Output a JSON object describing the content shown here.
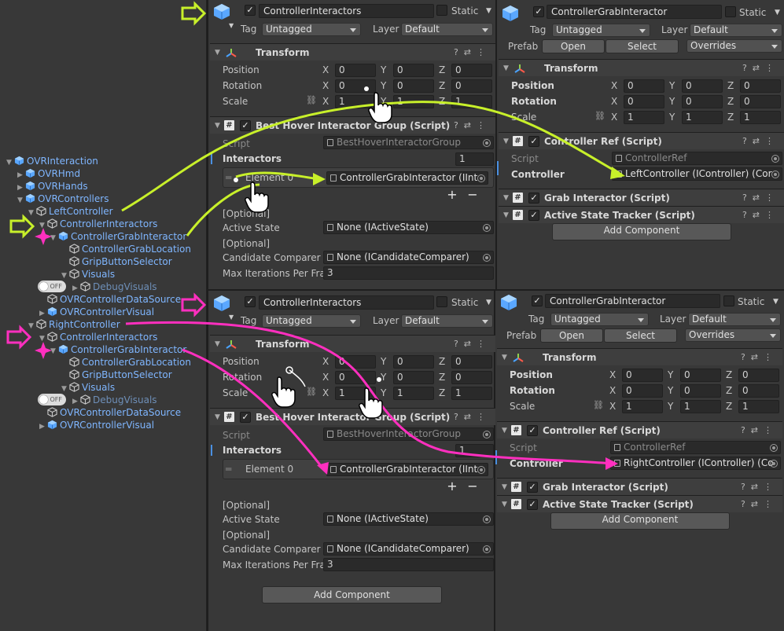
{
  "hierarchy": {
    "items": [
      {
        "label": "OVRInteraction",
        "indent": 0,
        "arrow": "▼",
        "icon": "prefab-icon"
      },
      {
        "label": "OVRHmd",
        "indent": 1,
        "arrow": "▶",
        "icon": "prefab-icon"
      },
      {
        "label": "OVRHands",
        "indent": 1,
        "arrow": "▶",
        "icon": "prefab-icon"
      },
      {
        "label": "OVRControllers",
        "indent": 1,
        "arrow": "▼",
        "icon": "prefab-icon"
      },
      {
        "label": "LeftController",
        "indent": 2,
        "arrow": "▼",
        "icon": "gameobject-icon"
      },
      {
        "label": "ControllerInteractors",
        "indent": 3,
        "arrow": "▼",
        "icon": "gameobject-icon"
      },
      {
        "label": "ControllerGrabInteractor",
        "indent": 4,
        "arrow": "▼",
        "icon": "prefab-icon"
      },
      {
        "label": "ControllerGrabLocation",
        "indent": 5,
        "arrow": "",
        "icon": "gameobject-icon"
      },
      {
        "label": "GripButtonSelector",
        "indent": 5,
        "arrow": "",
        "icon": "gameobject-icon"
      },
      {
        "label": "Visuals",
        "indent": 5,
        "arrow": "▼",
        "icon": "gameobject-icon"
      },
      {
        "label": "DebugVisuals",
        "indent": 6,
        "arrow": "▶",
        "icon": "gameobject-icon",
        "dim": true
      },
      {
        "label": "OVRControllerDataSource",
        "indent": 3,
        "arrow": "",
        "icon": "gameobject-icon"
      },
      {
        "label": "OVRControllerVisual",
        "indent": 3,
        "arrow": "▶",
        "icon": "prefab-icon"
      },
      {
        "label": "RightController",
        "indent": 2,
        "arrow": "▼",
        "icon": "gameobject-icon"
      },
      {
        "label": "ControllerInteractors",
        "indent": 3,
        "arrow": "▼",
        "icon": "gameobject-icon"
      },
      {
        "label": "ControllerGrabInteractor",
        "indent": 4,
        "arrow": "▼",
        "icon": "prefab-icon"
      },
      {
        "label": "ControllerGrabLocation",
        "indent": 5,
        "arrow": "",
        "icon": "gameobject-icon"
      },
      {
        "label": "GripButtonSelector",
        "indent": 5,
        "arrow": "",
        "icon": "gameobject-icon"
      },
      {
        "label": "Visuals",
        "indent": 5,
        "arrow": "▼",
        "icon": "gameobject-icon"
      },
      {
        "label": "DebugVisuals",
        "indent": 6,
        "arrow": "▶",
        "icon": "gameobject-icon",
        "dim": true
      },
      {
        "label": "OVRControllerDataSource",
        "indent": 3,
        "arrow": "",
        "icon": "gameobject-icon"
      },
      {
        "label": "OVRControllerVisual",
        "indent": 3,
        "arrow": "▶",
        "icon": "prefab-icon"
      }
    ],
    "toggle_label": "OFF"
  },
  "colors": {
    "highlight_green": "#c8f02a",
    "highlight_pink": "#ff2fbf",
    "link_blue": "#7fb6ff"
  },
  "common": {
    "static_label": "Static",
    "tag_label": "Tag",
    "layer_label": "Layer",
    "tag_value": "Untagged",
    "layer_value": "Default",
    "prefab_label": "Prefab",
    "open_label": "Open",
    "select_label": "Select",
    "overrides_label": "Overrides",
    "transform_label": "Transform",
    "position_label": "Position",
    "rotation_label": "Rotation",
    "scale_label": "Scale",
    "x": "X",
    "y": "Y",
    "z": "Z",
    "zero": "0",
    "one": "1",
    "best_hover_title": "Best Hover Interactor Group (Script)",
    "script_label": "Script",
    "script_value": "BestHoverInteractorGroup",
    "interactors_label": "Interactors",
    "interactors_count": "1",
    "element0_label": "Element 0",
    "element0_value": "ControllerGrabInteractor (IInt",
    "optional_label": "[Optional]",
    "active_state_label": "Active State",
    "active_state_value": "None (IActiveState)",
    "candidate_label": "Candidate Comparer",
    "candidate_value": "None (ICandidateComparer)",
    "max_iter_label": "Max Iterations Per Frar",
    "max_iter_value": "3",
    "add_component": "Add Component",
    "controller_ref_title": "Controller Ref (Script)",
    "script_ref_value": "ControllerRef",
    "controller_label": "Controller",
    "grab_interactor_title": "Grab Interactor (Script)",
    "active_state_tracker_title": "Active State Tracker (Script)",
    "plus": "+",
    "minus": "−"
  },
  "top_left": {
    "name": "ControllerInteractors"
  },
  "top_right": {
    "name": "ControllerGrabInteractor",
    "controller_value": "LeftController (IController) (Cor"
  },
  "bottom_left": {
    "name": "ControllerInteractors"
  },
  "bottom_right": {
    "name": "ControllerGrabInteractor",
    "controller_value": "RightController (IController) (Co"
  }
}
